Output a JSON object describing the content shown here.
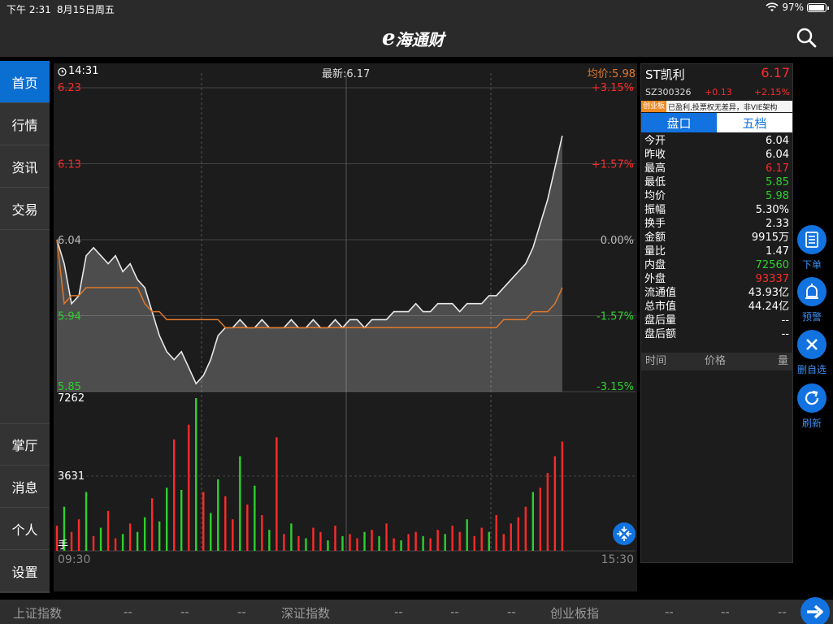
{
  "status_bar": {
    "time": "下午 2:31",
    "date": "8月15日周五",
    "battery": "97%",
    "battery_level": 0.97
  },
  "header": {
    "logo_e": "e",
    "logo_text": "海通财"
  },
  "sidebar": {
    "items": [
      {
        "label": "首页",
        "active": true
      },
      {
        "label": "行情"
      },
      {
        "label": "资讯"
      },
      {
        "label": "交易"
      },
      {
        "label": "掌厅"
      },
      {
        "label": "消息"
      },
      {
        "label": "个人"
      },
      {
        "label": "设置"
      }
    ]
  },
  "chart": {
    "time_label": "14:31",
    "latest_label": "最新:6.17",
    "avg_label": "均价:5.98",
    "price_axis": [
      "6.23",
      "6.13",
      "6.04",
      "5.94",
      "5.85"
    ],
    "pct_axis": [
      "+3.15%",
      "+1.57%",
      "0.00%",
      "-1.57%",
      "-3.15%"
    ],
    "volume_axis": [
      "7262",
      "3631"
    ],
    "volume_unit": "手",
    "time_start": "09:30",
    "time_end": "15:30",
    "colors": {
      "up": "#ff2a2a",
      "down": "#2dd12d",
      "avg": "#e0782b",
      "price": "#e8e8e8"
    }
  },
  "chart_data": {
    "type": "line",
    "title": "",
    "x_range": [
      "09:30",
      "15:00"
    ],
    "ylim": [
      5.85,
      6.23
    ],
    "prev_close": 6.04,
    "series": [
      {
        "values": [
          6.04,
          6.01,
          5.96,
          5.97,
          6.02,
          6.03,
          6.02,
          6.01,
          6.02,
          6.0,
          6.01,
          5.99,
          5.98,
          5.95,
          5.92,
          5.9,
          5.89,
          5.9,
          5.88,
          5.86,
          5.87,
          5.89,
          5.92,
          5.93,
          5.93,
          5.94,
          5.93,
          5.93,
          5.94,
          5.93,
          5.93,
          5.93,
          5.94,
          5.93,
          5.93,
          5.94,
          5.93,
          5.93,
          5.94,
          5.93,
          5.94,
          5.94,
          5.93,
          5.94,
          5.94,
          5.94,
          5.95,
          5.95,
          5.95,
          5.96,
          5.95,
          5.95,
          5.96,
          5.96,
          5.96,
          5.95,
          5.96,
          5.96,
          5.96,
          5.97,
          5.97,
          5.98,
          5.99,
          6.0,
          6.01,
          6.03,
          6.06,
          6.09,
          6.13,
          6.17
        ]
      },
      {
        "values": [
          6.04,
          5.96,
          5.97,
          5.97,
          5.98,
          5.98,
          5.98,
          5.98,
          5.98,
          5.98,
          5.98,
          5.98,
          5.96,
          5.95,
          5.95,
          5.94,
          5.94,
          5.94,
          5.94,
          5.94,
          5.94,
          5.94,
          5.94,
          5.93,
          5.93,
          5.93,
          5.93,
          5.93,
          5.93,
          5.93,
          5.93,
          5.93,
          5.93,
          5.93,
          5.93,
          5.93,
          5.93,
          5.93,
          5.93,
          5.93,
          5.93,
          5.93,
          5.93,
          5.93,
          5.93,
          5.93,
          5.93,
          5.93,
          5.93,
          5.93,
          5.93,
          5.93,
          5.93,
          5.93,
          5.93,
          5.93,
          5.93,
          5.93,
          5.93,
          5.93,
          5.93,
          5.94,
          5.94,
          5.94,
          5.94,
          5.95,
          5.95,
          5.95,
          5.96,
          5.98
        ]
      }
    ],
    "volume": {
      "ylim": [
        0,
        7262
      ],
      "values": [
        1200,
        2100,
        900,
        1500,
        2800,
        700,
        1100,
        1900,
        600,
        800,
        1300,
        900,
        1600,
        2500,
        1400,
        3000,
        5300,
        2900,
        6000,
        7262,
        2800,
        1800,
        3400,
        2600,
        1500,
        4500,
        2200,
        3100,
        1700,
        1000,
        5400,
        800,
        1300,
        700,
        600,
        1100,
        900,
        500,
        1200,
        700,
        800,
        600,
        900,
        1000,
        700,
        1300,
        600,
        500,
        800,
        900,
        700,
        600,
        1000,
        800,
        1200,
        900,
        1500,
        700,
        1100,
        900,
        1700,
        800,
        1300,
        1600,
        2100,
        2800,
        3000,
        3700,
        4500,
        5200
      ],
      "up": [
        true,
        false,
        true,
        true,
        false,
        true,
        false,
        true,
        true,
        false,
        true,
        false,
        false,
        true,
        false,
        false,
        true,
        false,
        true,
        false,
        true,
        false,
        false,
        true,
        true,
        false,
        true,
        false,
        true,
        false,
        true,
        true,
        false,
        true,
        false,
        true,
        true,
        false,
        true,
        false,
        true,
        true,
        false,
        true,
        false,
        true,
        true,
        false,
        true,
        true,
        false,
        true,
        true,
        false,
        true,
        true,
        false,
        true,
        true,
        false,
        true,
        true,
        true,
        true,
        true,
        false,
        true,
        true,
        true,
        true
      ]
    }
  },
  "quote": {
    "name": "ST凯利",
    "price": "6.17",
    "code": "SZ300326",
    "change": "+0.13",
    "change_pct": "+2.15%",
    "tag": "创业板",
    "tag_text": "已盈利,投票权无差异，非VIE架构",
    "tabs": [
      "盘口",
      "五档"
    ],
    "rows": [
      {
        "label": "今开",
        "value": "6.04",
        "color": "#ffffff"
      },
      {
        "label": "昨收",
        "value": "6.04",
        "color": "#ffffff"
      },
      {
        "label": "最高",
        "value": "6.17",
        "color": "#ff2a2a"
      },
      {
        "label": "最低",
        "value": "5.85",
        "color": "#2dd12d"
      },
      {
        "label": "均价",
        "value": "5.98",
        "color": "#2dd12d"
      },
      {
        "label": "振幅",
        "value": "5.30%",
        "color": "#ffffff"
      },
      {
        "label": "换手",
        "value": "2.33",
        "color": "#ffffff"
      },
      {
        "label": "金额",
        "value": "9915万",
        "color": "#ffffff"
      },
      {
        "label": "量比",
        "value": "1.47",
        "color": "#ffffff"
      },
      {
        "label": "内盘",
        "value": "72560",
        "color": "#2dd12d"
      },
      {
        "label": "外盘",
        "value": "93337",
        "color": "#ff2a2a"
      },
      {
        "label": "流通值",
        "value": "43.93亿",
        "color": "#ffffff"
      },
      {
        "label": "总市值",
        "value": "44.24亿",
        "color": "#ffffff"
      },
      {
        "label": "盘后量",
        "value": "--",
        "color": "#ffffff"
      },
      {
        "label": "盘后额",
        "value": "--",
        "color": "#ffffff"
      }
    ],
    "trade_head": {
      "time": "时间",
      "price": "价格",
      "volume": "量"
    }
  },
  "actions": [
    {
      "label": "下单",
      "icon": "order-icon"
    },
    {
      "label": "预警",
      "icon": "alarm-icon"
    },
    {
      "label": "删自选",
      "icon": "close-icon"
    },
    {
      "label": "刷新",
      "icon": "refresh-icon"
    }
  ],
  "ticker": {
    "sh_label": "上证指数",
    "sz_label": "深证指数",
    "cy_label": "创业板指",
    "placeholder": "--"
  }
}
